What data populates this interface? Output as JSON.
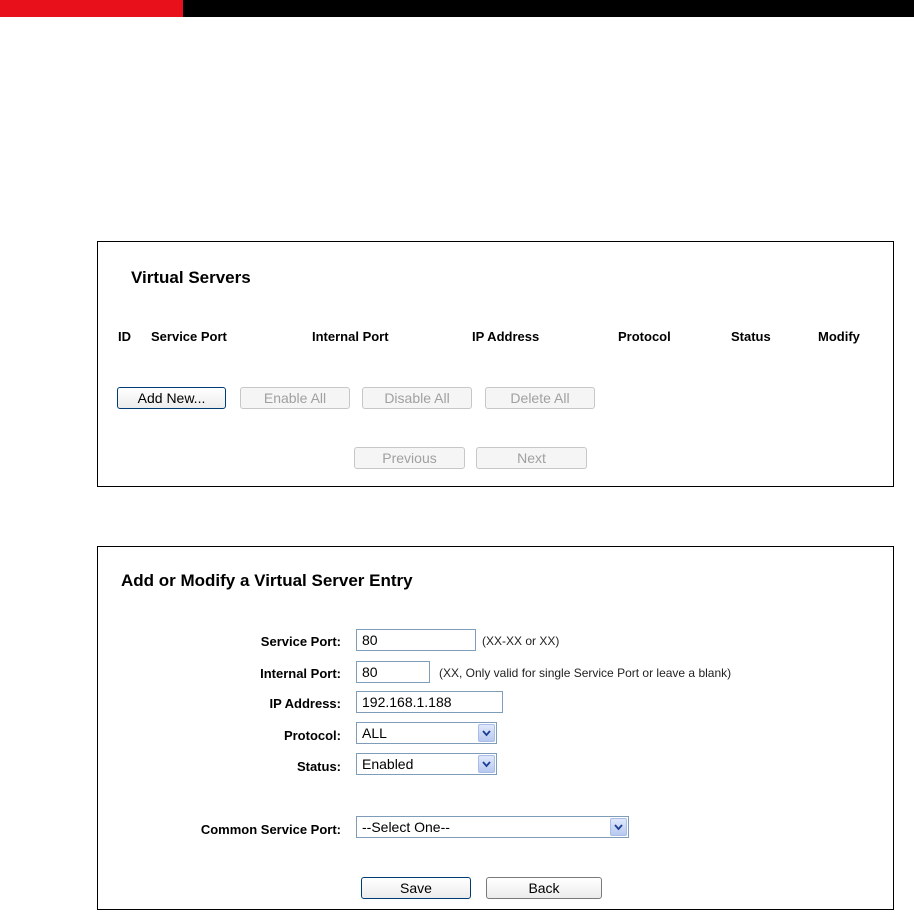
{
  "virtual_servers": {
    "title": "Virtual Servers",
    "columns": [
      "ID",
      "Service Port",
      "Internal Port",
      "IP Address",
      "Protocol",
      "Status",
      "Modify"
    ],
    "buttons": {
      "add_new": "Add New...",
      "enable_all": "Enable All",
      "disable_all": "Disable All",
      "delete_all": "Delete All",
      "previous": "Previous",
      "next": "Next"
    }
  },
  "entry_form": {
    "title": "Add or Modify a Virtual Server Entry",
    "service_port": {
      "label": "Service Port:",
      "value": "80",
      "hint": "(XX-XX or XX)"
    },
    "internal_port": {
      "label": "Internal Port:",
      "value": "80",
      "hint": "(XX, Only valid for single Service Port or leave a blank)"
    },
    "ip_address": {
      "label": "IP Address:",
      "value": "192.168.1.188"
    },
    "protocol": {
      "label": "Protocol:",
      "value": "ALL"
    },
    "status": {
      "label": "Status:",
      "value": "Enabled"
    },
    "common_service_port": {
      "label": "Common Service Port:",
      "value": "--Select One--"
    },
    "buttons": {
      "save": "Save",
      "back": "Back"
    }
  },
  "colors": {
    "accent_red": "#e8101a",
    "top_bar": "#000000"
  }
}
